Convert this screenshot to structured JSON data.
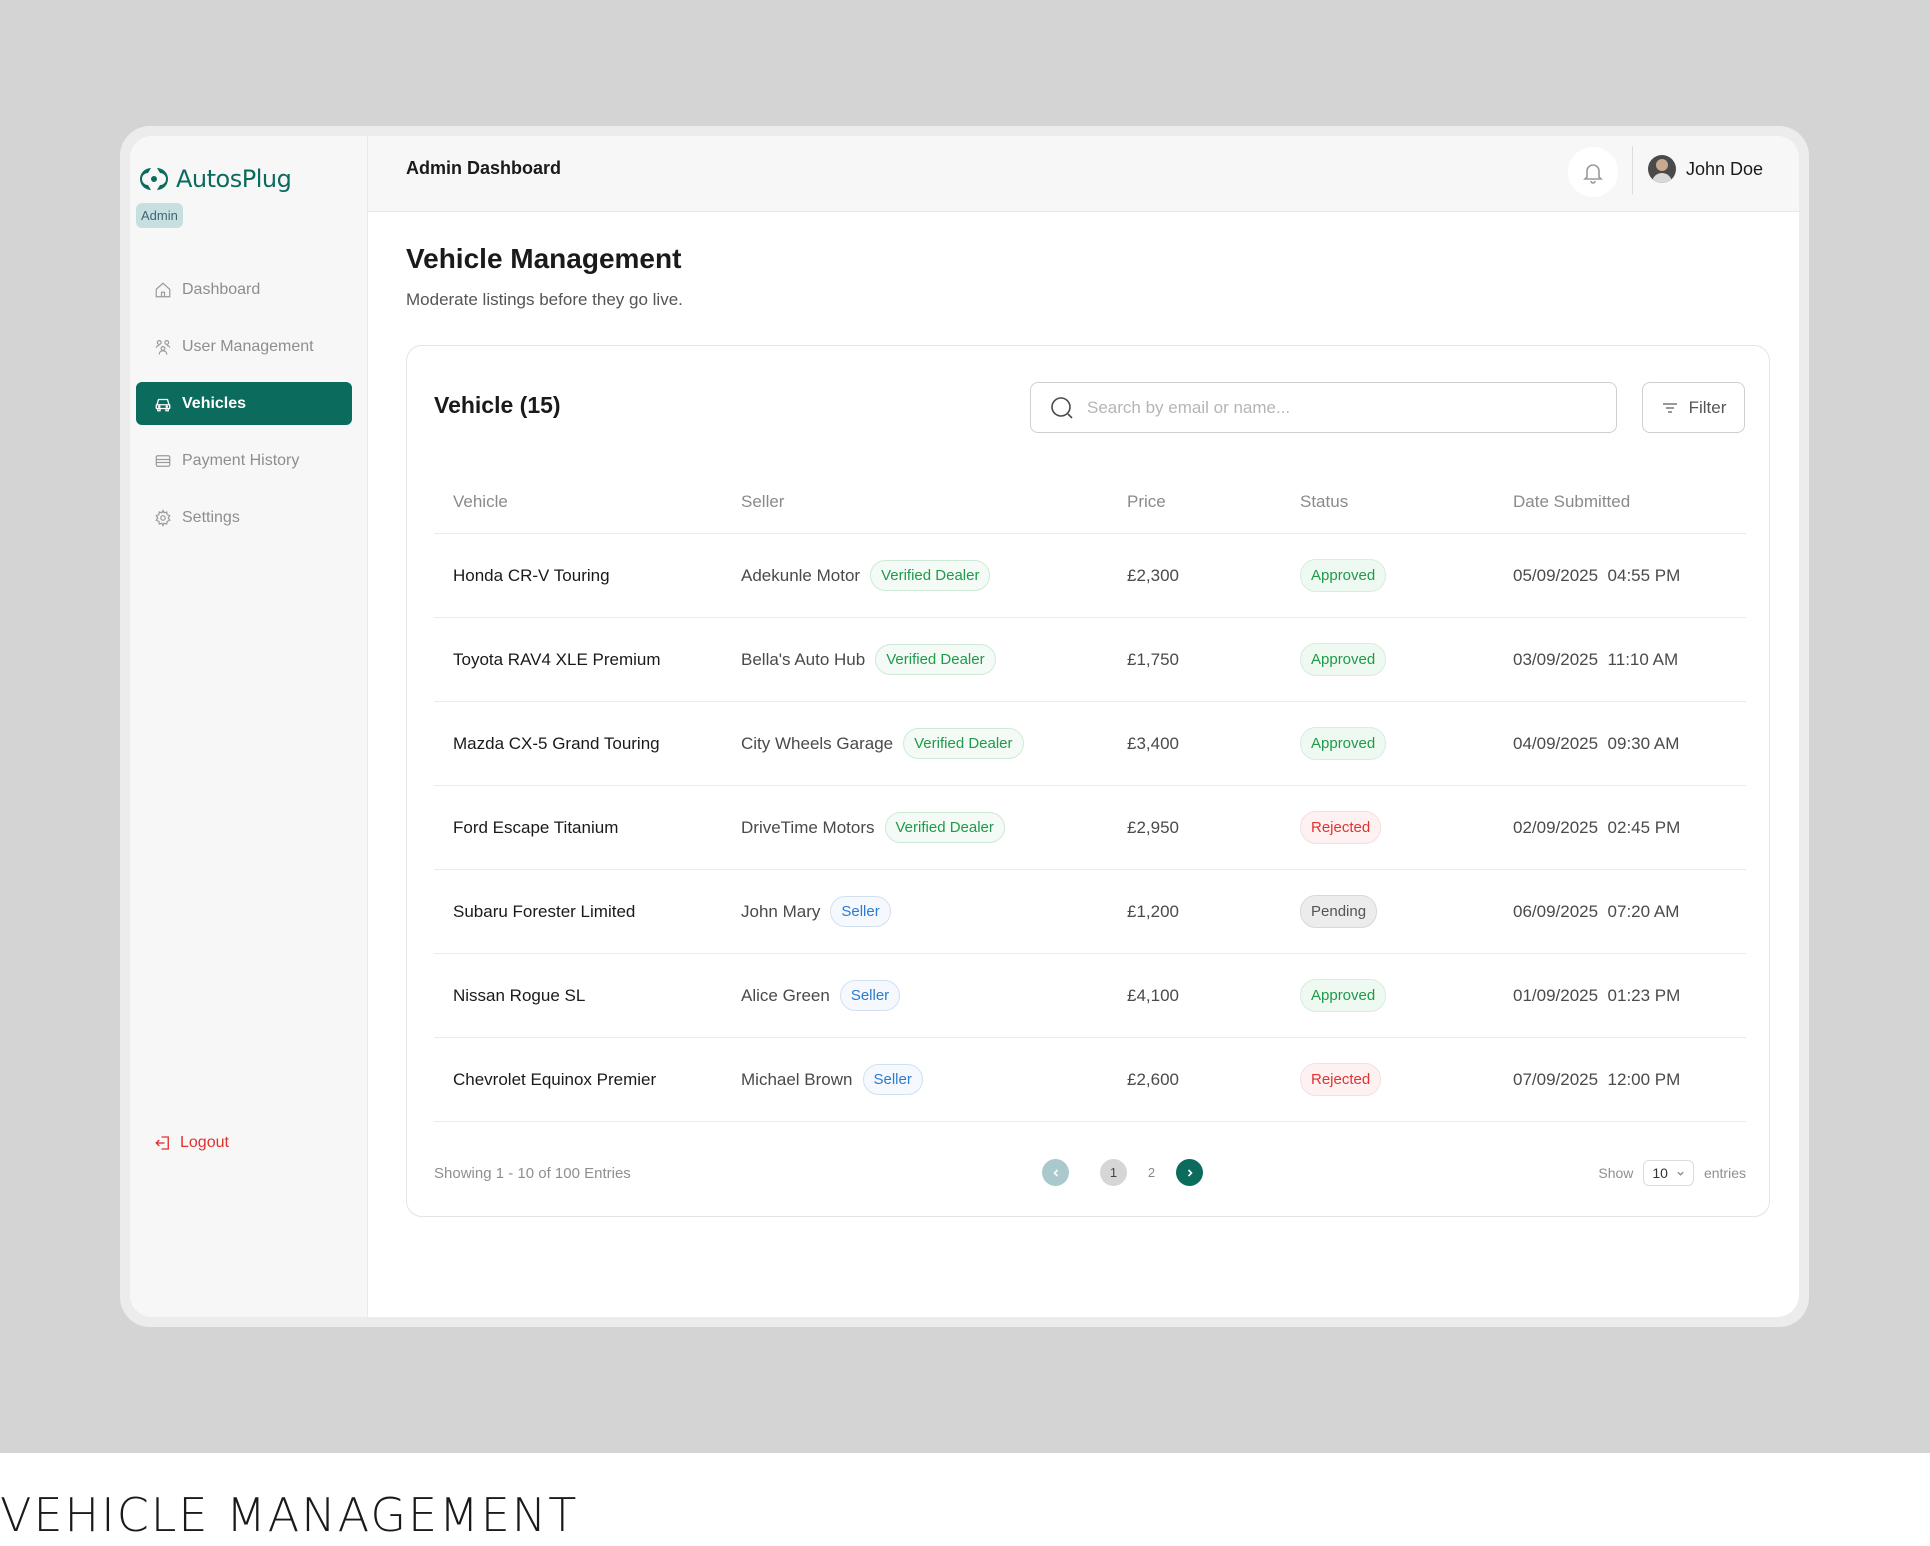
{
  "app": {
    "brand": "AutosPlug",
    "role_badge": "Admin"
  },
  "sidebar": {
    "items": [
      {
        "label": "Dashboard",
        "icon": "home-icon",
        "active": false
      },
      {
        "label": "User Management",
        "icon": "users-icon",
        "active": false
      },
      {
        "label": "Vehicles",
        "icon": "car-icon",
        "active": true
      },
      {
        "label": "Payment History",
        "icon": "card-icon",
        "active": false
      },
      {
        "label": "Settings",
        "icon": "gear-icon",
        "active": false
      }
    ],
    "logout_label": "Logout"
  },
  "topbar": {
    "title": "Admin Dashboard",
    "user_name": "John Doe"
  },
  "page": {
    "title": "Vehicle Management",
    "subtitle": "Moderate listings before they go live."
  },
  "card": {
    "title": "Vehicle (15)",
    "search_placeholder": "Search by email or name...",
    "filter_label": "Filter"
  },
  "table": {
    "headers": [
      "Vehicle",
      "Seller",
      "Price",
      "Status",
      "Date Submitted"
    ],
    "rows": [
      {
        "vehicle": "Honda CR-V Touring",
        "seller": "Adekunle Motor",
        "seller_type": "Verified Dealer",
        "price": "£2,300",
        "status": "Approved",
        "date": "05/09/2025",
        "time": "04:55 PM"
      },
      {
        "vehicle": "Toyota RAV4 XLE Premium",
        "seller": "Bella's Auto Hub",
        "seller_type": "Verified Dealer",
        "price": "£1,750",
        "status": "Approved",
        "date": "03/09/2025",
        "time": "11:10 AM"
      },
      {
        "vehicle": "Mazda CX-5 Grand Touring",
        "seller": "City Wheels Garage",
        "seller_type": "Verified Dealer",
        "price": "£3,400",
        "status": "Approved",
        "date": "04/09/2025",
        "time": "09:30 AM"
      },
      {
        "vehicle": "Ford Escape Titanium",
        "seller": "DriveTime Motors",
        "seller_type": "Verified Dealer",
        "price": "£2,950",
        "status": "Rejected",
        "date": "02/09/2025",
        "time": "02:45 PM"
      },
      {
        "vehicle": "Subaru Forester Limited",
        "seller": "John Mary",
        "seller_type": "Seller",
        "price": "£1,200",
        "status": "Pending",
        "date": "06/09/2025",
        "time": "07:20 AM"
      },
      {
        "vehicle": "Nissan Rogue SL",
        "seller": "Alice Green",
        "seller_type": "Seller",
        "price": "£4,100",
        "status": "Approved",
        "date": "01/09/2025",
        "time": "01:23 PM"
      },
      {
        "vehicle": "Chevrolet Equinox Premier",
        "seller": "Michael Brown",
        "seller_type": "Seller",
        "price": "£2,600",
        "status": "Rejected",
        "date": "07/09/2025",
        "time": "12:00 PM"
      }
    ]
  },
  "pagination": {
    "showing": "Showing 1 - 10 of 100 Entries",
    "pages": [
      "1",
      "2"
    ],
    "current_page": "1",
    "show_label": "Show",
    "per_page": "10",
    "entries_label": "entries"
  },
  "colors": {
    "brand": "#0b6b5d",
    "approved": "#1f9a4a",
    "rejected": "#e0332f",
    "seller_tag": "#2a7bd1"
  },
  "caption": "VEHICLE MANAGEMENT"
}
